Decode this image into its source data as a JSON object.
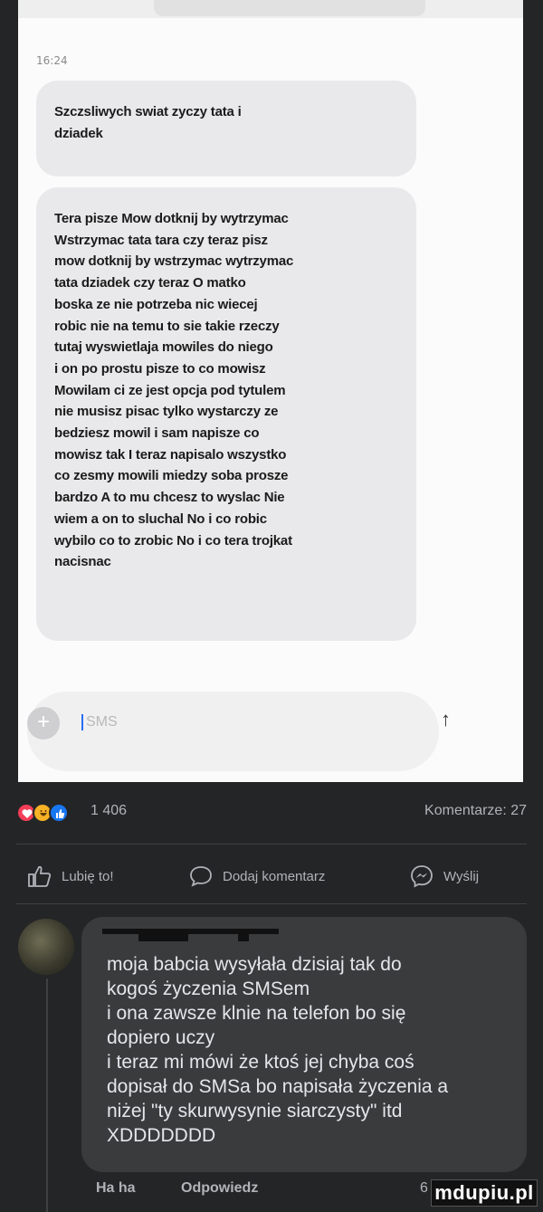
{
  "sms": {
    "time": "16:24",
    "messages": [
      "Szczsliwych swiat zyczy tata i\ndziadek",
      "Tera pisze Mow dotknij by wytrzymac\nWstrzymac tata tara czy teraz pisz\nmow dotknij by wstrzymac wytrzymac\ntata dziadek czy teraz O matko\nboska ze nie potrzeba nic wiecej\nrobic nie na temu to sie takie rzeczy\ntutaj wyswietlaja mowiles do niego\ni on po prostu pisze to co mowisz\nMowilam ci ze jest opcja pod tytulem\nnie musisz pisac tylko wystarczy ze\nbedziesz mowil i sam napisze co\nmowisz tak I teraz napisalo wszystko\nco zesmy mowili miedzy soba prosze\nbardzo A to mu chcesz to wyslac Nie\nwiem a on to sluchal No i co robic\nwybilo co to zrobic No i co tera trojkat\nnacisnac"
    ],
    "composer_placeholder": "SMS",
    "plus_icon": "plus-icon",
    "send_icon": "arrow-up-icon"
  },
  "post": {
    "reaction_count": "1 406",
    "comments_label": "Komentarze: 27",
    "actions": {
      "like": "Lubię to!",
      "comment": "Dodaj komentarz",
      "share": "Wyślij"
    },
    "colors": {
      "background": "#242526",
      "love": "#f33e58",
      "haha": "#f7b125",
      "like": "#1877f2"
    }
  },
  "comment": {
    "text": "moja babcia wysyłała dzisiaj tak do\nkogoś życzenia SMSem\ni ona zawsze klnie na telefon bo się\ndopiero uczy\ni teraz mi mówi że ktoś jej chyba coś\ndopisał do SMSa bo napisała życzenia a\nniżej \"ty skurwysynie siarczysty\" itd\nXDDDDDDD",
    "haha": "Ha ha",
    "reply": "Odpowiedz",
    "count_partial": "6"
  },
  "watermark": "mdupiu.pl"
}
